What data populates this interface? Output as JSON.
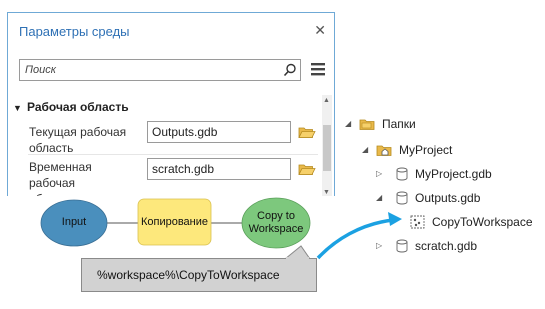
{
  "panel": {
    "title": "Параметры среды",
    "close_glyph": "✕",
    "search_placeholder": "Поиск",
    "section_title": "Рабочая область",
    "rows": [
      {
        "label_line1": "Текущая рабочая",
        "label_line2": "область",
        "value": "Outputs.gdb"
      },
      {
        "label_line1": "Временная рабочая",
        "label_line2": "область",
        "value": "scratch.gdb"
      }
    ]
  },
  "model": {
    "input_label": "Input",
    "tool_label": "Копирование",
    "output_label_line1": "Copy to",
    "output_label_line2": "Workspace",
    "callout_text": "%workspace%\\CopyToWorkspace",
    "colors": {
      "input_fill": "#4a8fbd",
      "tool_fill": "#fde87c",
      "output_fill": "#7dc87d",
      "arrow": "#1ba1e2"
    }
  },
  "catalog": {
    "root": "Папки",
    "project": "MyProject",
    "items": [
      "MyProject.gdb",
      "Outputs.gdb",
      "scratch.gdb"
    ],
    "child": "CopyToWorkspace"
  }
}
